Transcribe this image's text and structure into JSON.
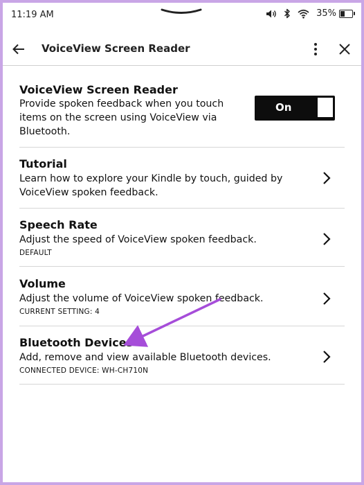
{
  "status_bar": {
    "time": "11:19 AM",
    "battery_percent": "35%",
    "battery_level": 0.35,
    "icons": [
      "volume-icon",
      "bluetooth-icon",
      "wifi-icon",
      "battery-icon"
    ]
  },
  "header": {
    "title": "VoiceView Screen Reader"
  },
  "main": {
    "toggle_row": {
      "title": "VoiceView Screen Reader",
      "description": "Provide spoken feedback when you touch items on the screen using VoiceView via Bluetooth.",
      "toggle_label": "On",
      "toggle_on": true
    },
    "items": [
      {
        "title": "Tutorial",
        "description": "Learn how to explore your Kindle by touch, guided by VoiceView spoken feedback.",
        "sub": ""
      },
      {
        "title": "Speech Rate",
        "description": "Adjust the speed of VoiceView spoken feedback.",
        "sub": "DEFAULT"
      },
      {
        "title": "Volume",
        "description": "Adjust the volume of VoiceView spoken feedback.",
        "sub": "CURRENT SETTING: 4"
      },
      {
        "title": "Bluetooth Devices",
        "description": "Add, remove and view available Bluetooth devices.",
        "sub": "CONNECTED DEVICE: WH-CH710N"
      }
    ]
  },
  "colors": {
    "frame_border": "#c9a6e6",
    "annotation_arrow": "#a64dd9",
    "toggle_bg": "#0d0d0d"
  }
}
